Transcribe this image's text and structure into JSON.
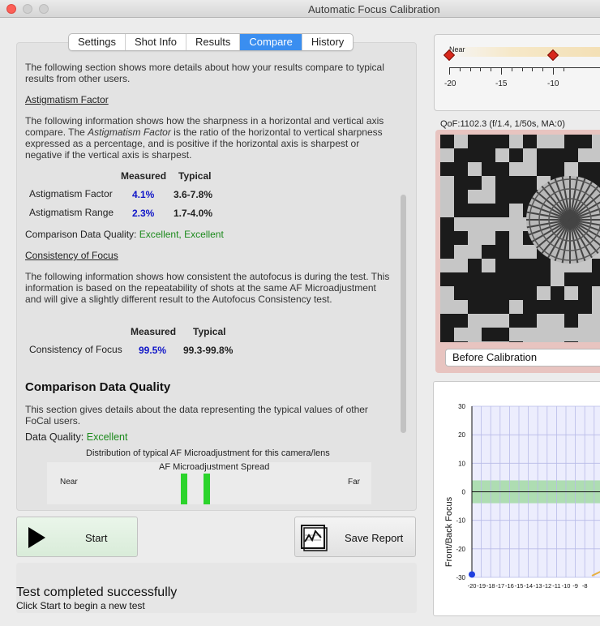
{
  "window": {
    "title": "Automatic Focus Calibration"
  },
  "tabs": [
    {
      "label": "Settings"
    },
    {
      "label": "Shot Info"
    },
    {
      "label": "Results"
    },
    {
      "label": "Compare"
    },
    {
      "label": "History"
    }
  ],
  "compare": {
    "intro": "The following section shows more details about how your results compare to typical results from other users.",
    "astig": {
      "heading": "Astigmatism Factor",
      "desc_part1": "The following information shows how the sharpness in a horizontal and vertical axis compare. The ",
      "desc_em": "Astigmatism Factor",
      "desc_part2": " is the ratio of the horizontal to vertical sharpness expressed as a percentage, and is positive if the horizontal axis is sharpest or negative if the vertical axis is sharpest.",
      "col_measured": "Measured",
      "col_typical": "Typical",
      "rows": [
        {
          "label": "Astigmatism Factor",
          "measured": "4.1%",
          "typical": "3.6-7.8%"
        },
        {
          "label": "Astigmatism Range",
          "measured": "2.3%",
          "typical": "1.7-4.0%"
        }
      ],
      "quality_label": "Comparison Data Quality:",
      "quality_value": "Excellent, Excellent"
    },
    "consistency": {
      "heading": "Consistency of Focus",
      "desc": "The following information shows how consistent the autofocus is during the test. This information is based on the repeatability of shots at the same AF Microadjustment and will give a slightly different result to the Autofocus Consistency test.",
      "col_measured": "Measured",
      "col_typical": "Typical",
      "row": {
        "label": "Consistency of Focus",
        "measured": "99.5%",
        "typical": "99.3-99.8%"
      }
    },
    "data_quality": {
      "heading": "Comparison Data Quality",
      "desc": "This section gives details about the data representing the typical values of other FoCal users.",
      "label": "Data Quality:",
      "value": "Excellent",
      "dist_title": "Distribution of typical AF Microadjustment for this camera/lens",
      "dist_subtitle": "AF Microadjustment Spread",
      "near": "Near",
      "far": "Far"
    }
  },
  "buttons": {
    "start": "Start",
    "save_report": "Save Report"
  },
  "status": {
    "title": "Test completed successfully",
    "sub": "Click Start to begin a new test"
  },
  "scale": {
    "near_label": "Near",
    "ticks": [
      "-20",
      "-15",
      "-10"
    ]
  },
  "preview": {
    "qof": "QoF:1102.3 (f/1.4, 1/50s, MA:0)",
    "select_value": "Before Calibration"
  },
  "chart_data": {
    "type": "line",
    "ylabel": "Front/Back Focus",
    "ylim": [
      -30,
      30
    ],
    "yticks": [
      "30",
      "20",
      "10",
      "0",
      "-10",
      "-20",
      "-30"
    ],
    "xticks": [
      "-20",
      "-19",
      "-18",
      "-17",
      "-16",
      "-15",
      "-14",
      "-13",
      "-12",
      "-11",
      "-10",
      "-9",
      "-8"
    ],
    "x": [
      -20
    ],
    "y": [
      -29
    ],
    "band": [
      -4,
      4
    ]
  },
  "colors": {
    "accent": "#3a8ef0",
    "good": "#1c8a1c",
    "measured": "#1016c8",
    "bar": "#2bd42b"
  }
}
